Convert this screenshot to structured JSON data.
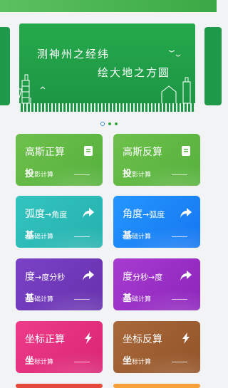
{
  "app": {
    "title": ""
  },
  "banner": {
    "line1": "测神州之经纬",
    "line2": "绘大地之方圆",
    "active_index": 0,
    "count": 3
  },
  "cards": [
    {
      "title_main": "高斯正算",
      "title_small": "",
      "sub_big": "投",
      "sub_small": "影计算",
      "icon": "document-icon",
      "color": "green"
    },
    {
      "title_main": "高斯反算",
      "title_small": "",
      "sub_big": "投",
      "sub_small": "影计算",
      "icon": "document-icon",
      "color": "green"
    },
    {
      "title_main": "弧度",
      "title_small": "→角度",
      "sub_big": "基",
      "sub_small": "础计算",
      "icon": "share-arrow-icon",
      "color": "teal"
    },
    {
      "title_main": "角度",
      "title_small": "→弧度",
      "sub_big": "基",
      "sub_small": "础计算",
      "icon": "share-arrow-icon",
      "color": "blue"
    },
    {
      "title_main": "度",
      "title_small": "→度分秒",
      "sub_big": "基",
      "sub_small": "础计算",
      "icon": "share-arrow-icon",
      "color": "purple"
    },
    {
      "title_main": "度",
      "title_small": "分秒→度",
      "sub_big": "基",
      "sub_small": "础计算",
      "icon": "share-arrow-icon",
      "color": "violet"
    },
    {
      "title_main": "坐标正算",
      "title_small": "",
      "sub_big": "坐",
      "sub_small": "标计算",
      "icon": "lightning-icon",
      "color": "pink"
    },
    {
      "title_main": "坐标反算",
      "title_small": "",
      "sub_big": "坐",
      "sub_small": "标计算",
      "icon": "lightning-icon",
      "color": "brown"
    }
  ]
}
